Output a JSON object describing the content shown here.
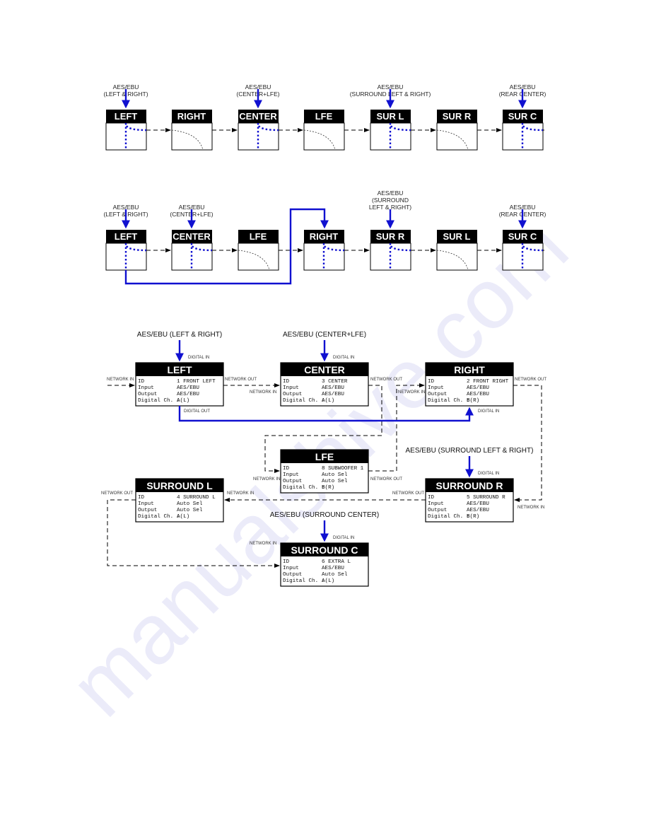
{
  "watermark": "manualshive.com",
  "colors": {
    "signal": "#1010d0",
    "header_bg": "#000000",
    "network": "#000000"
  },
  "diagram1": {
    "units": [
      {
        "label": "LEFT",
        "mode": "digital",
        "source": [
          "AES/EBU",
          "(LEFT & RIGHT)"
        ]
      },
      {
        "label": "RIGHT",
        "mode": "network"
      },
      {
        "label": "CENTER",
        "mode": "digital",
        "source": [
          "AES/EBU",
          "(CENTER+LFE)"
        ]
      },
      {
        "label": "LFE",
        "mode": "network"
      },
      {
        "label": "SUR L",
        "mode": "digital",
        "source": [
          "AES/EBU",
          "(SURROUND LEFT & RIGHT)"
        ]
      },
      {
        "label": "SUR R",
        "mode": "network"
      },
      {
        "label": "SUR C",
        "mode": "digital",
        "source": [
          "AES/EBU",
          "(REAR CENTER)"
        ]
      }
    ]
  },
  "diagram2": {
    "units": [
      {
        "label": "LEFT",
        "mode": "digital",
        "source": [
          "AES/EBU",
          "(LEFT & RIGHT)"
        ]
      },
      {
        "label": "CENTER",
        "mode": "digital",
        "source": [
          "AES/EBU",
          "(CENTER+LFE)"
        ]
      },
      {
        "label": "LFE",
        "mode": "network"
      },
      {
        "label": "RIGHT",
        "mode": "digital"
      },
      {
        "label": "SUR R",
        "mode": "digital",
        "source": [
          "AES/EBU",
          "(SURROUND",
          "LEFT & RIGHT)"
        ]
      },
      {
        "label": "SUR L",
        "mode": "network"
      },
      {
        "label": "SUR C",
        "mode": "digital",
        "source": [
          "AES/EBU",
          "(REAR CENTER)"
        ]
      }
    ]
  },
  "diagram3": {
    "port_labels": {
      "network_in": "NETWORK IN",
      "network_out": "NETWORK OUT",
      "digital_in": "DIGITAL IN",
      "digital_out": "DIGITAL OUT"
    },
    "field_names": {
      "id": "ID",
      "input": "Input",
      "output": "Output",
      "digital_ch": "Digital Ch. :"
    },
    "units": [
      {
        "label": "LEFT",
        "id": "1  FRONT LEFT",
        "input": "AES/EBU",
        "output": "AES/EBU",
        "digital_ch": "A(L)",
        "source": "AES/EBU (LEFT & RIGHT)"
      },
      {
        "label": "CENTER",
        "id": "3  CENTER",
        "input": "AES/EBU",
        "output": "AES/EBU",
        "digital_ch": "A(L)",
        "source": "AES/EBU (CENTER+LFE)"
      },
      {
        "label": "RIGHT",
        "id": "2  FRONT RIGHT",
        "input": "AES/EBU",
        "output": "AES/EBU",
        "digital_ch": "B(R)"
      },
      {
        "label": "LFE",
        "id": "8  SUBWOOFER 1",
        "input": "Auto Sel",
        "output": "Auto Sel",
        "digital_ch": "B(R)"
      },
      {
        "label": "SURROUND L",
        "id": "4  SURROUND L",
        "input": "Auto Sel",
        "output": "Auto Sel",
        "digital_ch": "A(L)"
      },
      {
        "label": "SURROUND R",
        "id": "5  SURROUND R",
        "input": "AES/EBU",
        "output": "AES/EBU",
        "digital_ch": "B(R)",
        "source": "AES/EBU (SURROUND LEFT & RIGHT)"
      },
      {
        "label": "SURROUND C",
        "id": "6  EXTRA L",
        "input": "AES/EBU",
        "output": "Auto Sel",
        "digital_ch": "A(L)",
        "source": "AES/EBU (SURROUND CENTER)"
      }
    ]
  }
}
